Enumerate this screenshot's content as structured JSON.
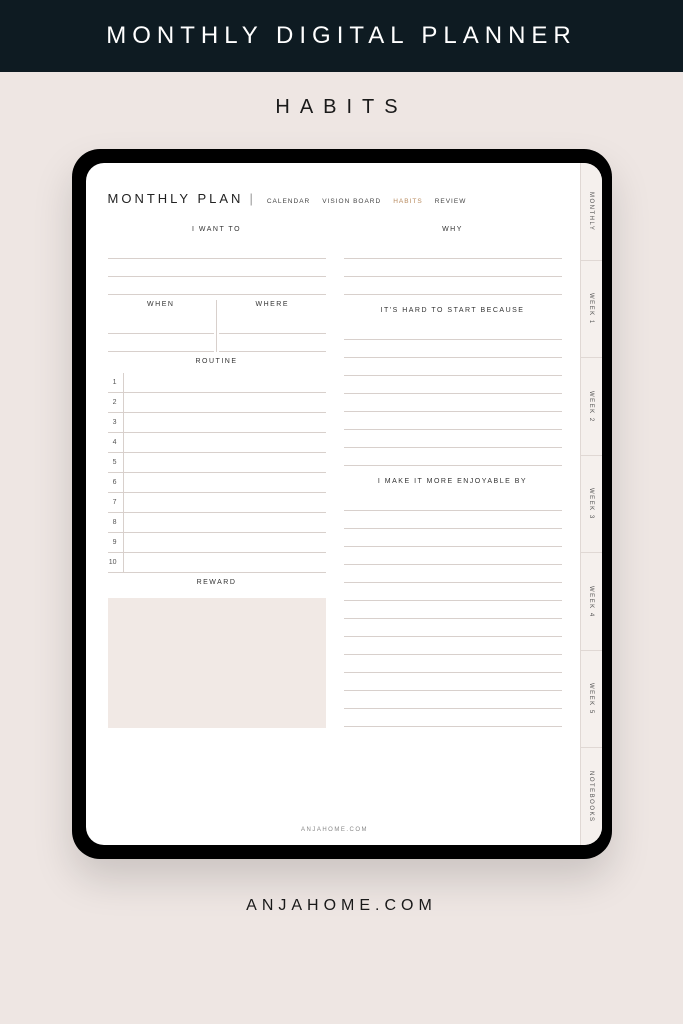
{
  "banner": "MONTHLY DIGITAL PLANNER",
  "subtitle": "HABITS",
  "page_title": "MONTHLY PLAN",
  "top_tabs": [
    "CALENDAR",
    "VISION BOARD",
    "HABITS",
    "REVIEW"
  ],
  "active_tab": "HABITS",
  "sections": {
    "want": "I WANT TO",
    "why": "WHY",
    "when": "WHEN",
    "where": "WHERE",
    "routine": "ROUTINE",
    "hard": "IT'S HARD TO START BECAUSE",
    "enjoy": "I MAKE IT MORE ENJOYABLE BY",
    "reward": "REWARD"
  },
  "routine_numbers": [
    "1",
    "2",
    "3",
    "4",
    "5",
    "6",
    "7",
    "8",
    "9",
    "10"
  ],
  "side_tabs": [
    "MONTHLY",
    "WEEK 1",
    "WEEK 2",
    "WEEK 3",
    "WEEK 4",
    "WEEK 5",
    "NOTEBOOKS"
  ],
  "footer_url": "ANJAHOME.COM",
  "brand": "ANJAHOME.COM"
}
